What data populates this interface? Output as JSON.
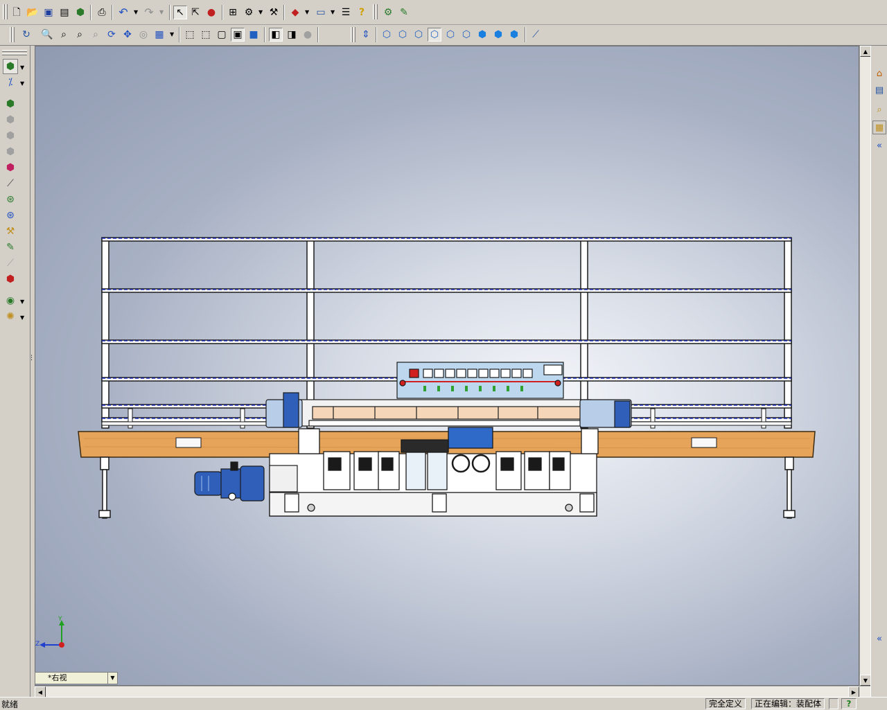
{
  "toolbar_top": {
    "buttons": [
      {
        "name": "new-document-icon",
        "glyph": "🗋"
      },
      {
        "name": "open-folder-icon",
        "glyph": "📂"
      },
      {
        "name": "save-icon",
        "glyph": "💾"
      },
      {
        "name": "print-icon",
        "glyph": "🖶"
      },
      {
        "name": "undo-icon",
        "glyph": "↶"
      },
      {
        "name": "redo-icon",
        "glyph": "↷"
      },
      {
        "name": "select-arrow-icon",
        "glyph": "↖"
      },
      {
        "name": "help-icon",
        "glyph": "?"
      }
    ]
  },
  "viewport": {
    "view_label": "*右视",
    "triad_y": "Y",
    "triad_z": "Z"
  },
  "status": {
    "left": "就绪",
    "cell1": "完全定义",
    "cell2": "正在编辑：装配体",
    "help": "?"
  },
  "colors": {
    "frame": "#1a1a1a",
    "guide_blue": "#1f2fc0",
    "wood": "#e6a45a",
    "motor_blue": "#2f5fb8",
    "panel_blue": "#bcd7ee"
  }
}
